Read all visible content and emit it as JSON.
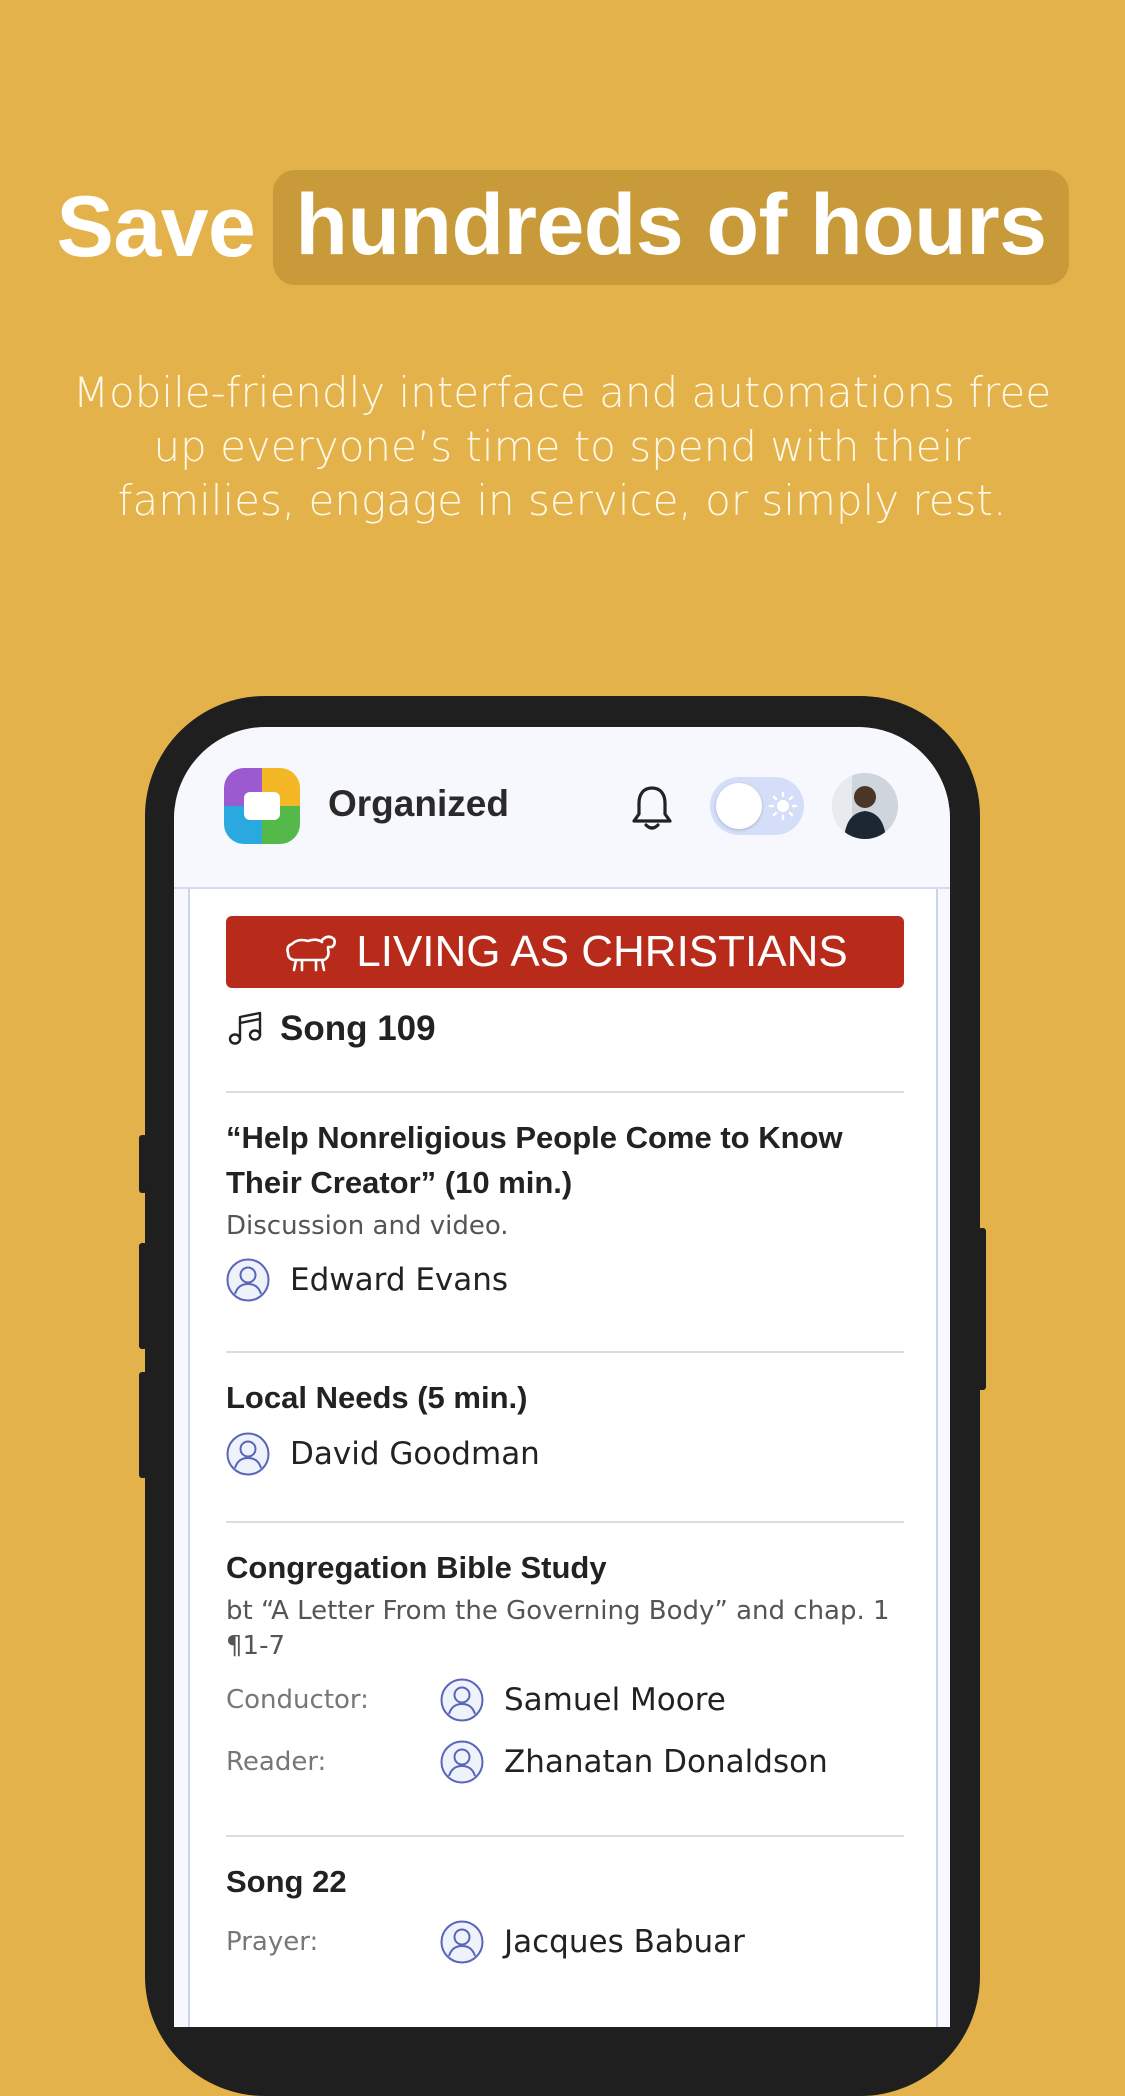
{
  "headline": {
    "plain": "Save",
    "highlight": "hundreds of hours"
  },
  "subtitle": "Mobile-friendly interface and automations free up everyone’s time to spend with their families, engage in service, or simply rest.",
  "app": {
    "title": "Organized"
  },
  "section": {
    "title": "LIVING AS CHRISTIANS",
    "icon": "sheep-icon",
    "color": "#b82b1a"
  },
  "opening_song": "Song 109",
  "parts": [
    {
      "title": "“Help Nonreligious People Come to Know Their Creator” (10 min.)",
      "description": "Discussion and video.",
      "assignee": "Edward Evans"
    },
    {
      "title": "Local Needs (5 min.)",
      "assignee": "David Goodman"
    },
    {
      "title": "Congregation Bible Study",
      "description": "bt “A Letter From the Governing Body” and chap. 1 ¶1-7",
      "roles": [
        {
          "label": "Conductor:",
          "name": "Samuel Moore"
        },
        {
          "label": "Reader:",
          "name": "Zhanatan Donaldson"
        }
      ]
    }
  ],
  "closing": {
    "song": "Song 22",
    "role_label": "Prayer:",
    "name": "Jacques Babuar"
  },
  "colors": {
    "background": "#e3b24a",
    "phone": "#1f1f1f",
    "accent": "#b82b1a"
  }
}
